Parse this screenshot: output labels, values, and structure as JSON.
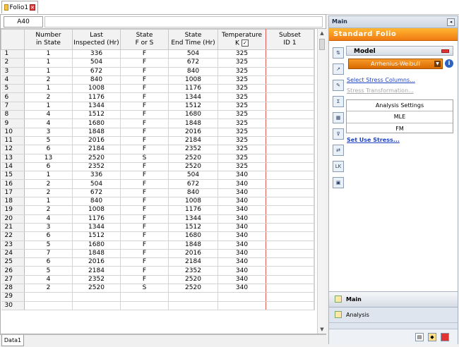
{
  "tab": {
    "label": "Folio1"
  },
  "namebox": {
    "cell": "A40"
  },
  "columns": [
    "Number\nin State",
    "Last\nInspected (Hr)",
    "State\nF or S",
    "State\nEnd Time (Hr)",
    "Temperature\nK",
    "Subset\nID 1"
  ],
  "rows": [
    [
      "1",
      "336",
      "F",
      "504",
      "325"
    ],
    [
      "1",
      "504",
      "F",
      "672",
      "325"
    ],
    [
      "1",
      "672",
      "F",
      "840",
      "325"
    ],
    [
      "2",
      "840",
      "F",
      "1008",
      "325"
    ],
    [
      "1",
      "1008",
      "F",
      "1176",
      "325"
    ],
    [
      "2",
      "1176",
      "F",
      "1344",
      "325"
    ],
    [
      "1",
      "1344",
      "F",
      "1512",
      "325"
    ],
    [
      "4",
      "1512",
      "F",
      "1680",
      "325"
    ],
    [
      "4",
      "1680",
      "F",
      "1848",
      "325"
    ],
    [
      "3",
      "1848",
      "F",
      "2016",
      "325"
    ],
    [
      "5",
      "2016",
      "F",
      "2184",
      "325"
    ],
    [
      "6",
      "2184",
      "F",
      "2352",
      "325"
    ],
    [
      "13",
      "2520",
      "S",
      "2520",
      "325"
    ],
    [
      "6",
      "2352",
      "F",
      "2520",
      "325"
    ],
    [
      "1",
      "336",
      "F",
      "504",
      "340"
    ],
    [
      "2",
      "504",
      "F",
      "672",
      "340"
    ],
    [
      "2",
      "672",
      "F",
      "840",
      "340"
    ],
    [
      "1",
      "840",
      "F",
      "1008",
      "340"
    ],
    [
      "2",
      "1008",
      "F",
      "1176",
      "340"
    ],
    [
      "4",
      "1176",
      "F",
      "1344",
      "340"
    ],
    [
      "3",
      "1344",
      "F",
      "1512",
      "340"
    ],
    [
      "6",
      "1512",
      "F",
      "1680",
      "340"
    ],
    [
      "5",
      "1680",
      "F",
      "1848",
      "340"
    ],
    [
      "7",
      "1848",
      "F",
      "2016",
      "340"
    ],
    [
      "6",
      "2016",
      "F",
      "2184",
      "340"
    ],
    [
      "5",
      "2184",
      "F",
      "2352",
      "340"
    ],
    [
      "4",
      "2352",
      "F",
      "2520",
      "340"
    ],
    [
      "2",
      "2520",
      "S",
      "2520",
      "340"
    ],
    [
      "",
      "",
      "",
      "",
      ""
    ],
    [
      "",
      "",
      "",
      "",
      ""
    ]
  ],
  "sheet_tab": "Data1",
  "panel": {
    "title": "Main",
    "banner": "Standard Folio",
    "model_label": "Model",
    "model_value": "Arrhenius-Weibull",
    "select_stress": "Select Stress Columns...",
    "stress_transform": "Stress Transformation...",
    "analysis_settings": "Analysis Settings",
    "mle": "MLE",
    "fm": "FM",
    "set_use_stress": "Set Use Stress...",
    "nav_main": "Main",
    "nav_analysis": "Analysis"
  },
  "icon_names": [
    "stress-columns-icon",
    "plot-icon",
    "transform-icon",
    "calc-icon",
    "select-icon",
    "filter-icon",
    "transfer-icon",
    "lk-icon",
    "report-icon"
  ]
}
